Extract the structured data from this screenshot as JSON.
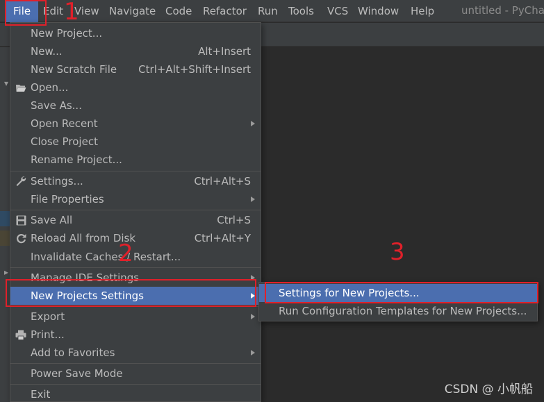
{
  "menubar": {
    "items": [
      {
        "name": "menu-file",
        "label": "File"
      },
      {
        "name": "menu-edit",
        "label": "Edit"
      },
      {
        "name": "menu-view",
        "label": "View"
      },
      {
        "name": "menu-navigate",
        "label": "Navigate"
      },
      {
        "name": "menu-code",
        "label": "Code"
      },
      {
        "name": "menu-refactor",
        "label": "Refactor"
      },
      {
        "name": "menu-run",
        "label": "Run"
      },
      {
        "name": "menu-tools",
        "label": "Tools"
      },
      {
        "name": "menu-vcs",
        "label": "VCS"
      },
      {
        "name": "menu-window",
        "label": "Window"
      },
      {
        "name": "menu-help",
        "label": "Help"
      }
    ],
    "window_title": "untitled - PyCharm"
  },
  "file_menu": {
    "items": [
      {
        "label": "New Project...",
        "shortcut": ""
      },
      {
        "label": "New...",
        "shortcut": "Alt+Insert"
      },
      {
        "label": "New Scratch File",
        "shortcut": "Ctrl+Alt+Shift+Insert"
      },
      {
        "label": "Open...",
        "shortcut": "",
        "icon": "folder-icon"
      },
      {
        "label": "Save As...",
        "shortcut": ""
      },
      {
        "label": "Open Recent",
        "shortcut": "",
        "submenu": true
      },
      {
        "label": "Close Project",
        "shortcut": ""
      },
      {
        "label": "Rename Project...",
        "shortcut": ""
      },
      {
        "label": "Settings...",
        "shortcut": "Ctrl+Alt+S",
        "icon": "wrench-icon"
      },
      {
        "label": "File Properties",
        "shortcut": "",
        "submenu": true
      },
      {
        "label": "Save All",
        "shortcut": "Ctrl+S",
        "icon": "save-icon"
      },
      {
        "label": "Reload All from Disk",
        "shortcut": "Ctrl+Alt+Y",
        "icon": "reload-icon"
      },
      {
        "label": "Invalidate Caches / Restart...",
        "shortcut": ""
      },
      {
        "label": "Manage IDE Settings",
        "shortcut": "",
        "submenu": true
      },
      {
        "label": "New Projects Settings",
        "shortcut": "",
        "submenu": true,
        "highlighted": true
      },
      {
        "label": "Export",
        "shortcut": "",
        "submenu": true
      },
      {
        "label": "Print...",
        "shortcut": "",
        "icon": "printer-icon"
      },
      {
        "label": "Add to Favorites",
        "shortcut": "",
        "submenu": true
      },
      {
        "label": "Power Save Mode",
        "shortcut": ""
      },
      {
        "label": "Exit",
        "shortcut": ""
      }
    ]
  },
  "submenu": {
    "items": [
      {
        "label": "Settings for New Projects...",
        "highlighted": true
      },
      {
        "label": "Run Configuration Templates for New Projects..."
      }
    ]
  },
  "annotations": {
    "step1": "1",
    "step2": "2",
    "step3": "3"
  },
  "watermark": "CSDN @ 小帆船",
  "colors": {
    "menu_bg": "#3c3f41",
    "highlight": "#4b6eaf",
    "annotation_red": "#e0202a",
    "editor_bg": "#2b2b2b"
  }
}
